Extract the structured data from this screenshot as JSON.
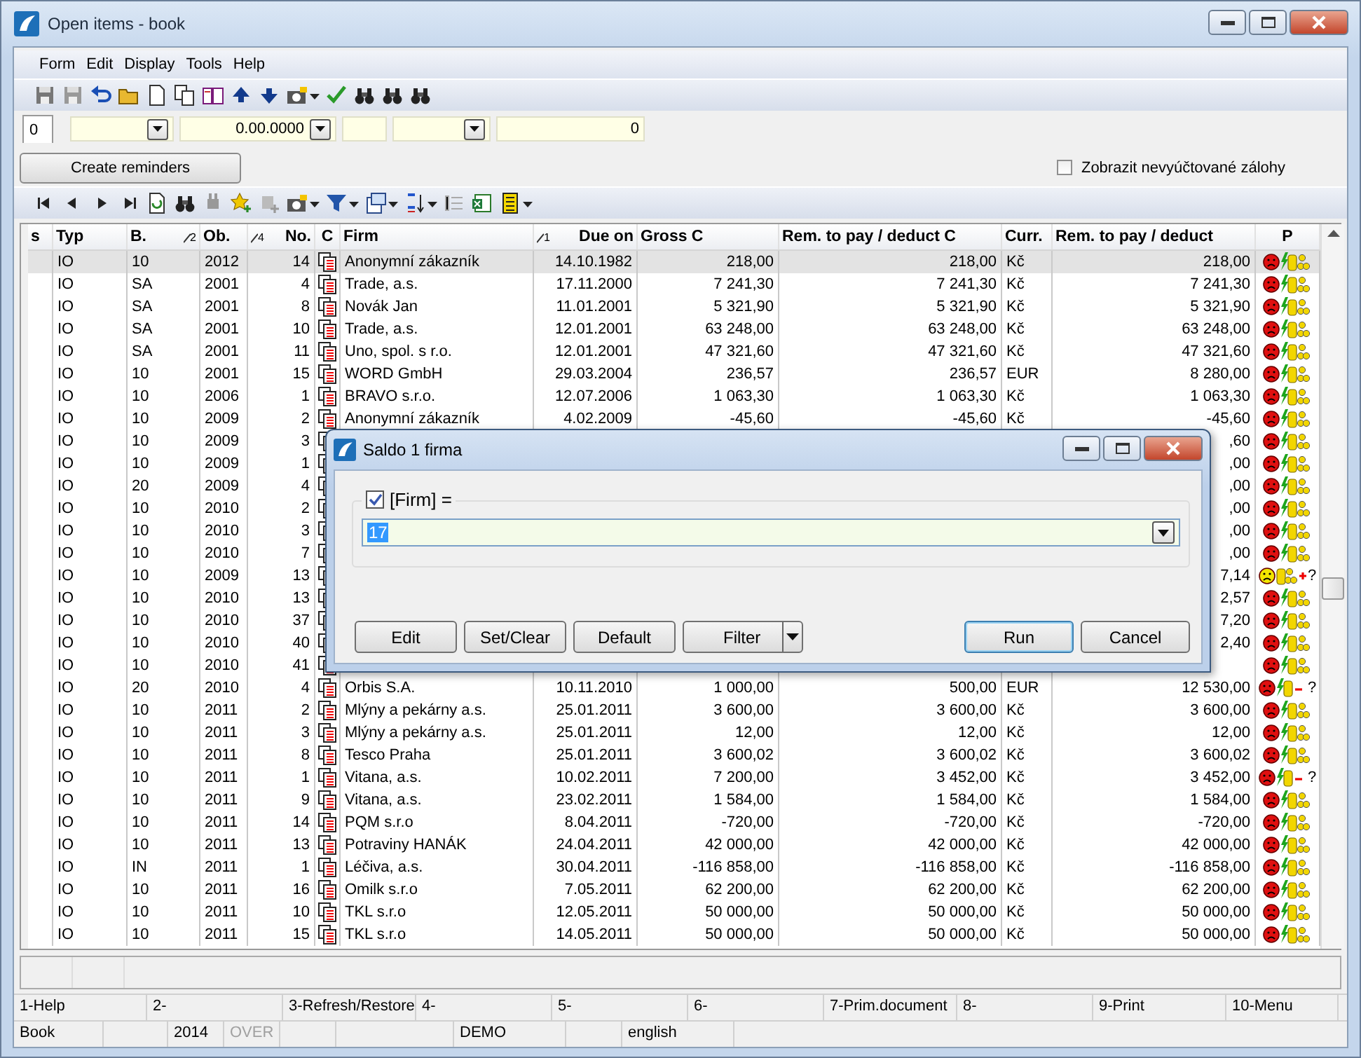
{
  "window": {
    "title": "Open items - book"
  },
  "menu": [
    "Form",
    "Edit",
    "Display",
    "Tools",
    "Help"
  ],
  "filter_bar": {
    "tab": "0",
    "fields": [
      {
        "kind": "combo"
      },
      {
        "kind": "combo",
        "value": "0.00.0000"
      },
      {
        "kind": "text"
      },
      {
        "kind": "combo"
      },
      {
        "kind": "text",
        "value": "0"
      }
    ]
  },
  "create_button": "Create reminders",
  "show_unbilled": {
    "label": "Zobrazit nevyúčtované zálohy",
    "checked": false
  },
  "table": {
    "columns": [
      {
        "label": "s"
      },
      {
        "label": "Typ"
      },
      {
        "label": "B.",
        "sort": "2"
      },
      {
        "label": "Ob."
      },
      {
        "label": "No.",
        "sort": "4"
      },
      {
        "label": "C"
      },
      {
        "label": "Firm"
      },
      {
        "label": "Due on",
        "sort": "1"
      },
      {
        "label": "Gross C"
      },
      {
        "label": "Rem. to pay / deduct C"
      },
      {
        "label": "Curr."
      },
      {
        "label": "Rem. to pay / deduct"
      },
      {
        "label": "P"
      }
    ],
    "rows": [
      {
        "typ": "IO",
        "b": "10",
        "ob": "2012",
        "no": "14",
        "firm": "Anonymní zákazník",
        "due": "14.10.1982",
        "gross": "218,00",
        "rem_c": "218,00",
        "curr": "Kč",
        "rem": "218,00",
        "kind": "overdue",
        "selected": true
      },
      {
        "typ": "IO",
        "b": "SA",
        "ob": "2001",
        "no": "4",
        "firm": "Trade, a.s.",
        "due": "17.11.2000",
        "gross": "7 241,30",
        "rem_c": "7 241,30",
        "curr": "Kč",
        "rem": "7 241,30",
        "kind": "overdue",
        "selected": false
      },
      {
        "typ": "IO",
        "b": "SA",
        "ob": "2001",
        "no": "8",
        "firm": "Novák Jan",
        "due": "11.01.2001",
        "gross": "5 321,90",
        "rem_c": "5 321,90",
        "curr": "Kč",
        "rem": "5 321,90",
        "kind": "overdue",
        "selected": false
      },
      {
        "typ": "IO",
        "b": "SA",
        "ob": "2001",
        "no": "10",
        "firm": "Trade, a.s.",
        "due": "12.01.2001",
        "gross": "63 248,00",
        "rem_c": "63 248,00",
        "curr": "Kč",
        "rem": "63 248,00",
        "kind": "overdue",
        "selected": false
      },
      {
        "typ": "IO",
        "b": "SA",
        "ob": "2001",
        "no": "11",
        "firm": "Uno, spol. s r.o.",
        "due": "12.01.2001",
        "gross": "47 321,60",
        "rem_c": "47 321,60",
        "curr": "Kč",
        "rem": "47 321,60",
        "kind": "overdue",
        "selected": false
      },
      {
        "typ": "IO",
        "b": "10",
        "ob": "2001",
        "no": "15",
        "firm": "WORD GmbH",
        "due": "29.03.2004",
        "gross": "236,57",
        "rem_c": "236,57",
        "curr": "EUR",
        "rem": "8 280,00",
        "kind": "overdue",
        "selected": false
      },
      {
        "typ": "IO",
        "b": "10",
        "ob": "2006",
        "no": "1",
        "firm": "BRAVO s.r.o.",
        "due": "12.07.2006",
        "gross": "1 063,30",
        "rem_c": "1 063,30",
        "curr": "Kč",
        "rem": "1 063,30",
        "kind": "overdue",
        "selected": false
      },
      {
        "typ": "IO",
        "b": "10",
        "ob": "2009",
        "no": "2",
        "firm": "Anonymní zákazník",
        "due": "4.02.2009",
        "gross": "-45,60",
        "rem_c": "-45,60",
        "curr": "Kč",
        "rem": "-45,60",
        "kind": "overdue",
        "selected": false
      },
      {
        "typ": "IO",
        "b": "10",
        "ob": "2009",
        "no": "3",
        "rem": ",60",
        "kind": "overdue",
        "selected": false
      },
      {
        "typ": "IO",
        "b": "10",
        "ob": "2009",
        "no": "1",
        "rem": ",00",
        "kind": "overdue",
        "selected": false
      },
      {
        "typ": "IO",
        "b": "20",
        "ob": "2009",
        "no": "4",
        "rem": ",00",
        "kind": "overdue",
        "selected": false
      },
      {
        "typ": "IO",
        "b": "10",
        "ob": "2010",
        "no": "2",
        "rem": ",00",
        "kind": "overdue",
        "selected": false
      },
      {
        "typ": "IO",
        "b": "10",
        "ob": "2010",
        "no": "3",
        "rem": ",00",
        "kind": "overdue",
        "selected": false
      },
      {
        "typ": "IO",
        "b": "10",
        "ob": "2010",
        "no": "7",
        "rem": ",00",
        "kind": "overdue",
        "selected": false
      },
      {
        "typ": "IO",
        "b": "10",
        "ob": "2009",
        "no": "13",
        "rem": "7,14",
        "kind": "warning",
        "mark": "?",
        "selected": false
      },
      {
        "typ": "IO",
        "b": "10",
        "ob": "2010",
        "no": "13",
        "rem": "2,57",
        "kind": "overdue",
        "selected": false
      },
      {
        "typ": "IO",
        "b": "10",
        "ob": "2010",
        "no": "37",
        "rem": "7,20",
        "kind": "overdue",
        "selected": false
      },
      {
        "typ": "IO",
        "b": "10",
        "ob": "2010",
        "no": "40",
        "rem": "2,40",
        "kind": "overdue",
        "selected": false
      },
      {
        "typ": "IO",
        "b": "10",
        "ob": "2010",
        "no": "41",
        "kind": "overdue",
        "selected": false
      },
      {
        "typ": "IO",
        "b": "20",
        "ob": "2010",
        "no": "4",
        "firm": "Orbis S.A.",
        "due": "10.11.2010",
        "gross": "1 000,00",
        "rem_c": "500,00",
        "curr": "EUR",
        "rem": "12 530,00",
        "kind": "query",
        "mark": "?",
        "selected": false
      },
      {
        "typ": "IO",
        "b": "10",
        "ob": "2011",
        "no": "2",
        "firm": "Mlýny a pekárny a.s.",
        "due": "25.01.2011",
        "gross": "3 600,00",
        "rem_c": "3 600,00",
        "curr": "Kč",
        "rem": "3 600,00",
        "kind": "overdue",
        "selected": false
      },
      {
        "typ": "IO",
        "b": "10",
        "ob": "2011",
        "no": "3",
        "firm": "Mlýny a pekárny a.s.",
        "due": "25.01.2011",
        "gross": "12,00",
        "rem_c": "12,00",
        "curr": "Kč",
        "rem": "12,00",
        "kind": "overdue",
        "selected": false
      },
      {
        "typ": "IO",
        "b": "10",
        "ob": "2011",
        "no": "8",
        "firm": "Tesco Praha",
        "due": "25.01.2011",
        "gross": "3 600,02",
        "rem_c": "3 600,02",
        "curr": "Kč",
        "rem": "3 600,02",
        "kind": "overdue",
        "selected": false
      },
      {
        "typ": "IO",
        "b": "10",
        "ob": "2011",
        "no": "1",
        "firm": "Vitana, a.s.",
        "due": "10.02.2011",
        "gross": "7 200,00",
        "rem_c": "3 452,00",
        "curr": "Kč",
        "rem": "3 452,00",
        "kind": "query",
        "mark": "?",
        "selected": false
      },
      {
        "typ": "IO",
        "b": "10",
        "ob": "2011",
        "no": "9",
        "firm": "Vitana, a.s.",
        "due": "23.02.2011",
        "gross": "1 584,00",
        "rem_c": "1 584,00",
        "curr": "Kč",
        "rem": "1 584,00",
        "kind": "overdue",
        "selected": false
      },
      {
        "typ": "IO",
        "b": "10",
        "ob": "2011",
        "no": "14",
        "firm": "PQM s.r.o",
        "due": "8.04.2011",
        "gross": "-720,00",
        "rem_c": "-720,00",
        "curr": "Kč",
        "rem": "-720,00",
        "kind": "overdue",
        "selected": false
      },
      {
        "typ": "IO",
        "b": "10",
        "ob": "2011",
        "no": "13",
        "firm": "Potraviny HANÁK",
        "due": "24.04.2011",
        "gross": "42 000,00",
        "rem_c": "42 000,00",
        "curr": "Kč",
        "rem": "42 000,00",
        "kind": "overdue",
        "selected": false
      },
      {
        "typ": "IO",
        "b": "IN",
        "ob": "2011",
        "no": "1",
        "firm": "Léčiva, a.s.",
        "due": "30.04.2011",
        "gross": "-116 858,00",
        "rem_c": "-116 858,00",
        "curr": "Kč",
        "rem": "-116 858,00",
        "kind": "overdue",
        "selected": false
      },
      {
        "typ": "IO",
        "b": "10",
        "ob": "2011",
        "no": "16",
        "firm": "Omilk s.r.o",
        "due": "7.05.2011",
        "gross": "62 200,00",
        "rem_c": "62 200,00",
        "curr": "Kč",
        "rem": "62 200,00",
        "kind": "overdue",
        "selected": false
      },
      {
        "typ": "IO",
        "b": "10",
        "ob": "2011",
        "no": "10",
        "firm": "TKL s.r.o",
        "due": "12.05.2011",
        "gross": "50 000,00",
        "rem_c": "50 000,00",
        "curr": "Kč",
        "rem": "50 000,00",
        "kind": "overdue",
        "selected": false
      },
      {
        "typ": "IO",
        "b": "10",
        "ob": "2011",
        "no": "15",
        "firm": "TKL s.r.o",
        "due": "14.05.2011",
        "gross": "50 000,00",
        "rem_c": "50 000,00",
        "curr": "Kč",
        "rem": "50 000,00",
        "kind": "overdue",
        "selected": false
      }
    ]
  },
  "function_keys": [
    "1-Help",
    "2-",
    "3-Refresh/Restore",
    "4-",
    "5-",
    "6-",
    "7-Prim.document",
    "8-",
    "9-Print",
    "10-Menu"
  ],
  "status_bar": [
    {
      "text": "Book",
      "disabled": false
    },
    {
      "text": "2014",
      "disabled": false
    },
    {
      "text": "OVER",
      "disabled": true
    },
    {
      "text": "DEMO",
      "disabled": false
    },
    {
      "text": "english",
      "disabled": false
    }
  ],
  "dialog": {
    "title": "Saldo 1 firma",
    "condition": {
      "label": "[Firm] =",
      "checked": true,
      "value": "17"
    },
    "left_buttons": [
      {
        "label": "Edit",
        "kind": "plain",
        "default": false
      },
      {
        "label": "Set/Clear",
        "kind": "plain",
        "default": false
      },
      {
        "label": "Default",
        "kind": "plain",
        "default": false
      },
      {
        "label": "Filter",
        "kind": "split",
        "default": false
      }
    ],
    "right_buttons": [
      {
        "label": "Run",
        "default": true
      },
      {
        "label": "Cancel",
        "default": false
      }
    ]
  }
}
